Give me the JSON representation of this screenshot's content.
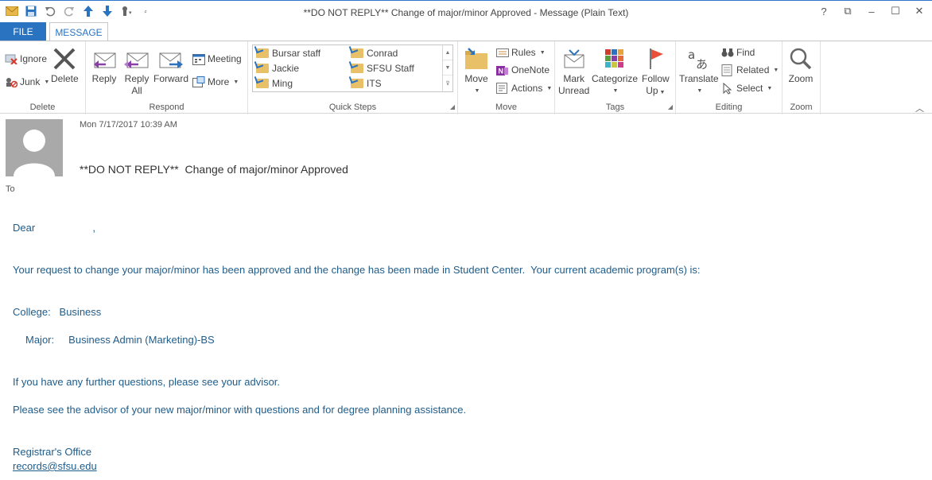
{
  "window": {
    "title": "**DO NOT REPLY**  Change of major/minor Approved - Message (Plain Text)",
    "controls": {
      "help": "?",
      "restore_ribbon": "⧉",
      "minimize": "–",
      "maximize": "☐",
      "close": "✕"
    }
  },
  "tabs": {
    "file": "FILE",
    "message": "MESSAGE"
  },
  "ribbon": {
    "delete_group": {
      "label": "Delete",
      "ignore": "Ignore",
      "junk": "Junk",
      "delete": "Delete"
    },
    "respond_group": {
      "label": "Respond",
      "reply": "Reply",
      "reply_all_line1": "Reply",
      "reply_all_line2": "All",
      "forward": "Forward",
      "meeting": "Meeting",
      "more": "More"
    },
    "quick_steps_group": {
      "label": "Quick Steps",
      "items": [
        "Bursar staff",
        "Conrad",
        "Jackie",
        "SFSU Staff",
        "Ming",
        "ITS"
      ]
    },
    "move_group": {
      "label": "Move",
      "move": "Move",
      "rules": "Rules",
      "onenote": "OneNote",
      "actions": "Actions"
    },
    "tags_group": {
      "label": "Tags",
      "mark_line1": "Mark",
      "mark_line2": "Unread",
      "categorize": "Categorize",
      "follow_line1": "Follow",
      "follow_line2": "Up"
    },
    "editing_group": {
      "label": "Editing",
      "translate": "Translate",
      "find": "Find",
      "related": "Related",
      "select": "Select"
    },
    "zoom_group": {
      "label": "Zoom",
      "zoom": "Zoom"
    }
  },
  "message": {
    "date": "Mon 7/17/2017 10:39 AM",
    "subject": "**DO NOT REPLY**  Change of major/minor Approved",
    "to_label": "To",
    "greeting": "Dear                    ,",
    "p1": "Your request to change your major/minor has been approved and the change has been made in Student Center.  Your current academic program(s) is:",
    "college": "College:   Business",
    "major": "Major:     Business Admin (Marketing)-BS",
    "p2": "If you have any further questions, please see your advisor.",
    "p3": "Please see the advisor of your new major/minor with questions and for degree planning assistance.",
    "signature": "Registrar's Office",
    "email": "records@sfsu.edu"
  },
  "colors": {
    "accent": "#2a73c1",
    "body_text": "#1f5c8a"
  }
}
